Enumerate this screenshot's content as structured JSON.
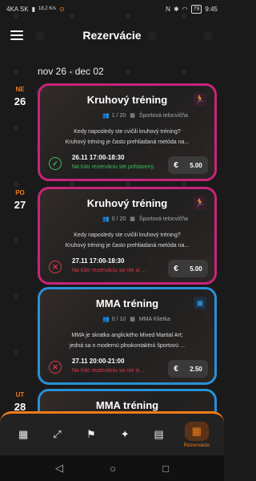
{
  "status_bar": {
    "left_text": "4KA SK",
    "speed": "18,2 K/s",
    "right_text": "79",
    "time": "9:45"
  },
  "header": {
    "title": "Rezervácie"
  },
  "date_range": "nov 26 - dec 02",
  "days": [
    {
      "name": "NE",
      "date": "26"
    },
    {
      "name": "PO",
      "date": "27"
    },
    {
      "name": "UT",
      "date": "28"
    }
  ],
  "cards": [
    {
      "title": "Kruhový tréning",
      "capacity": "1 / 20",
      "location": "Športová telocvičňa",
      "desc_line1": "Kedy naposledy ste cvičili kruhový tréning?",
      "desc_line2": "Kruhový tréning je často prehliadaná metóda na...",
      "time": "26.11 17:00-18:30",
      "note": "Na túto rezerváciu ste sa prihlásili.",
      "note_display": "Na túto rezerváciu ste prihlasený.",
      "price": "5.00",
      "currency": "€",
      "status": "ok",
      "color": "#c8247d"
    },
    {
      "title": "Kruhový tréning",
      "capacity": "0 / 20",
      "location": "Športová telocvičňa",
      "desc_line1": "Kedy naposledy ste cvičili kruhový tréning?",
      "desc_line2": "Kruhový tréning je často prehliadaná metóda na...",
      "time": "27.11 17:00-18:30",
      "note": "Na túto rezerváciu sa nie si ...",
      "price": "5.00",
      "currency": "€",
      "status": "err",
      "color": "#c8247d"
    },
    {
      "title": "MMA tréning",
      "capacity": "0 / 10",
      "location": "MMA Klietka",
      "desc_line1": "MMA je skratka anglického Mixed Martial Art;",
      "desc_line2": "jedná sa o modernú plnokontaktnú športovú ...",
      "time": "27.11 20:00-21:00",
      "note": "Na túto rezerváciu sa nie si ...",
      "price": "2.50",
      "currency": "€",
      "status": "err",
      "color": "#2a8fd6"
    },
    {
      "title": "MMA tréning"
    }
  ],
  "bottom_nav": {
    "active_label": "Rezervácie"
  }
}
